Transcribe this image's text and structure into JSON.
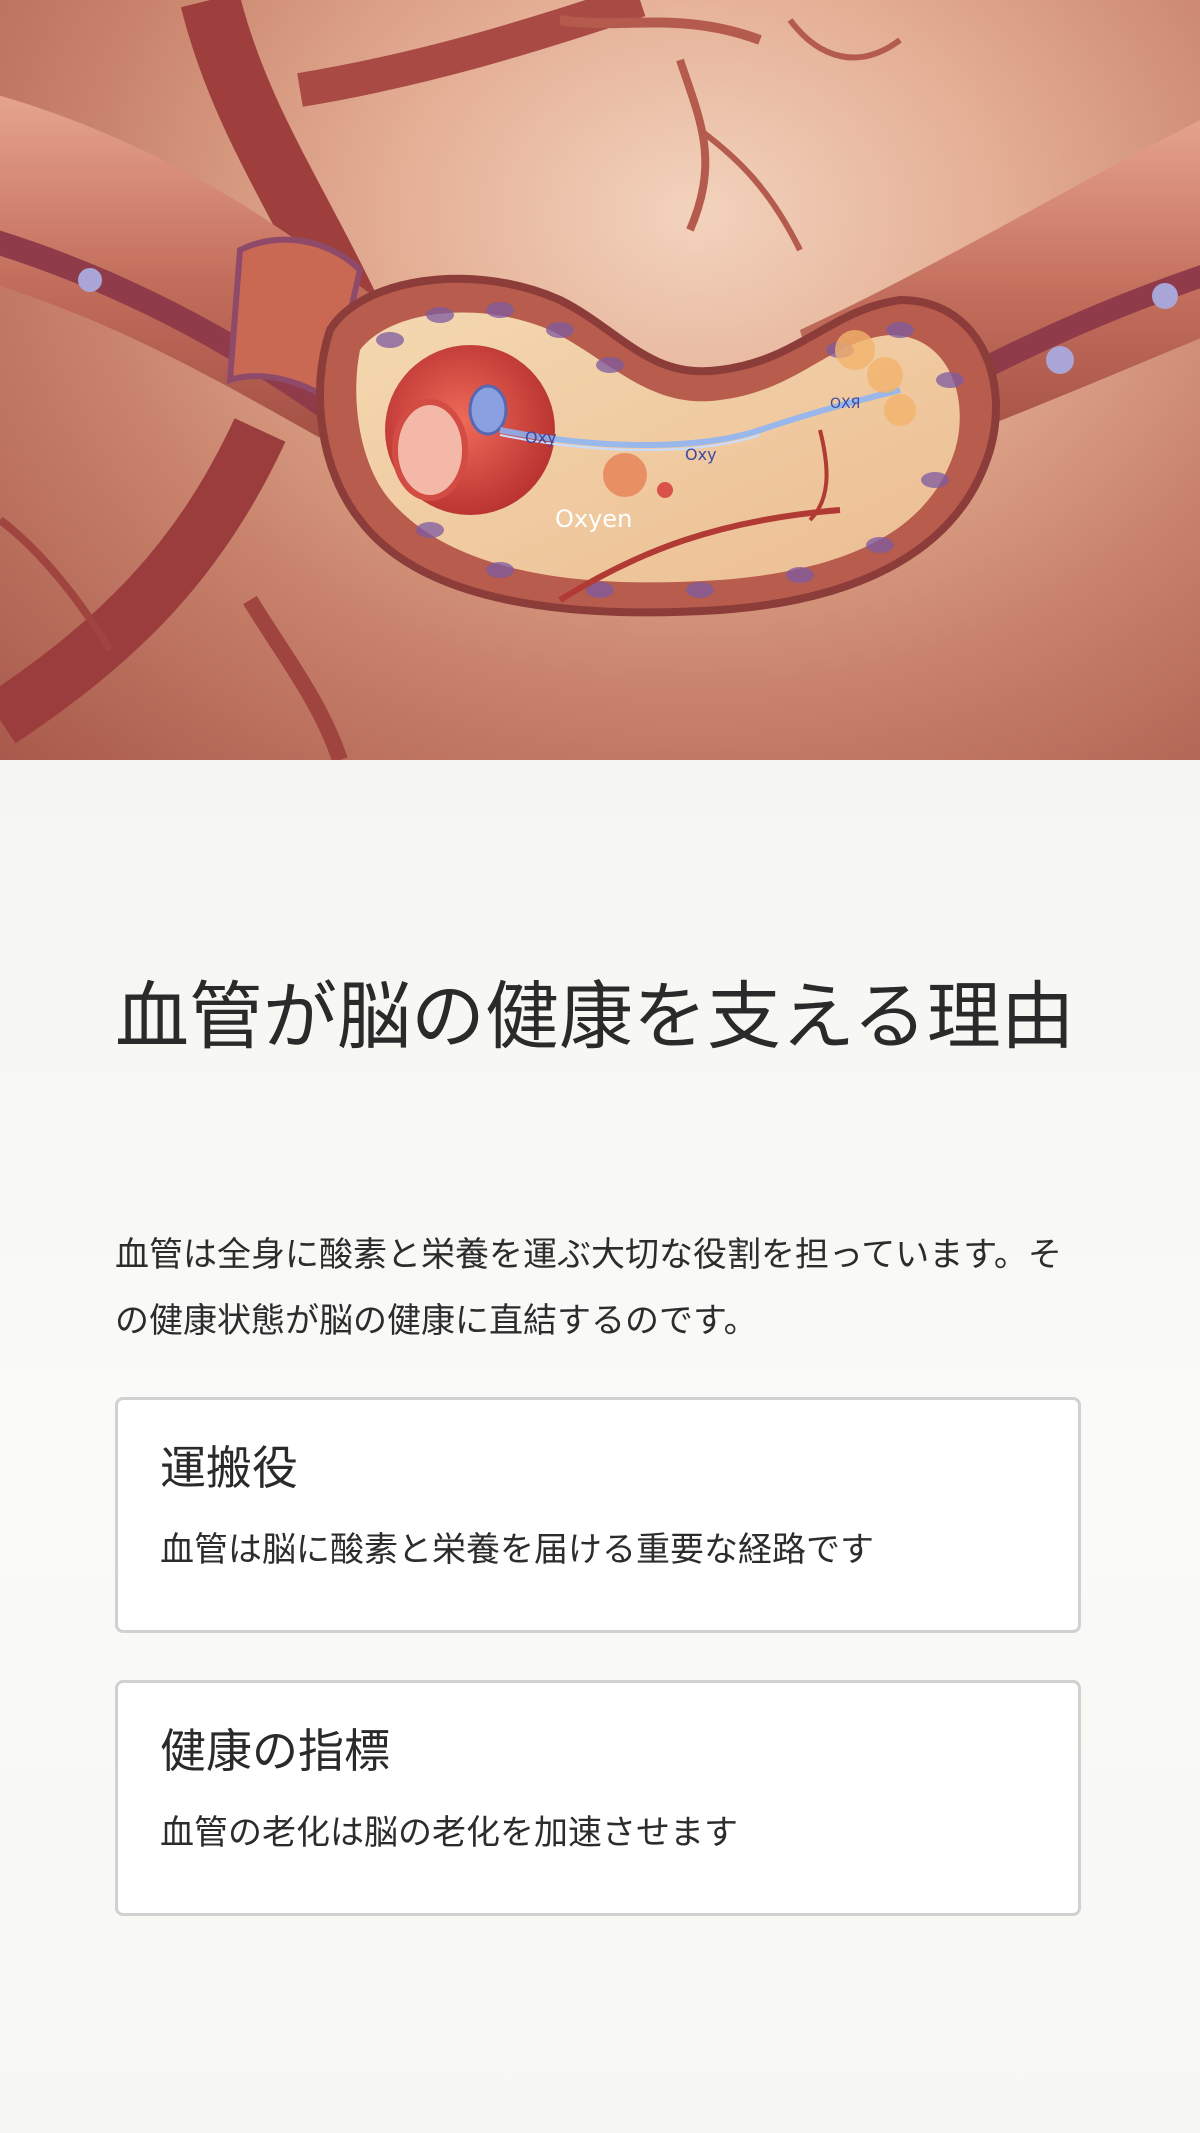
{
  "hero": {
    "labels": [
      "Oxy",
      "Oxy",
      "Oxyen",
      "ОХЯ"
    ]
  },
  "article": {
    "title": "血管が脳の健康を支える理由",
    "intro": "血管は全身に酸素と栄養を運ぶ大切な役割を担っています。その健康状態が脳の健康に直結するのです。",
    "cards": [
      {
        "heading": "運搬役",
        "text": "血管は脳に酸素と栄養を届ける重要な経路です"
      },
      {
        "heading": "健康の指標",
        "text": "血管の老化は脳の老化を加速させます"
      }
    ]
  }
}
